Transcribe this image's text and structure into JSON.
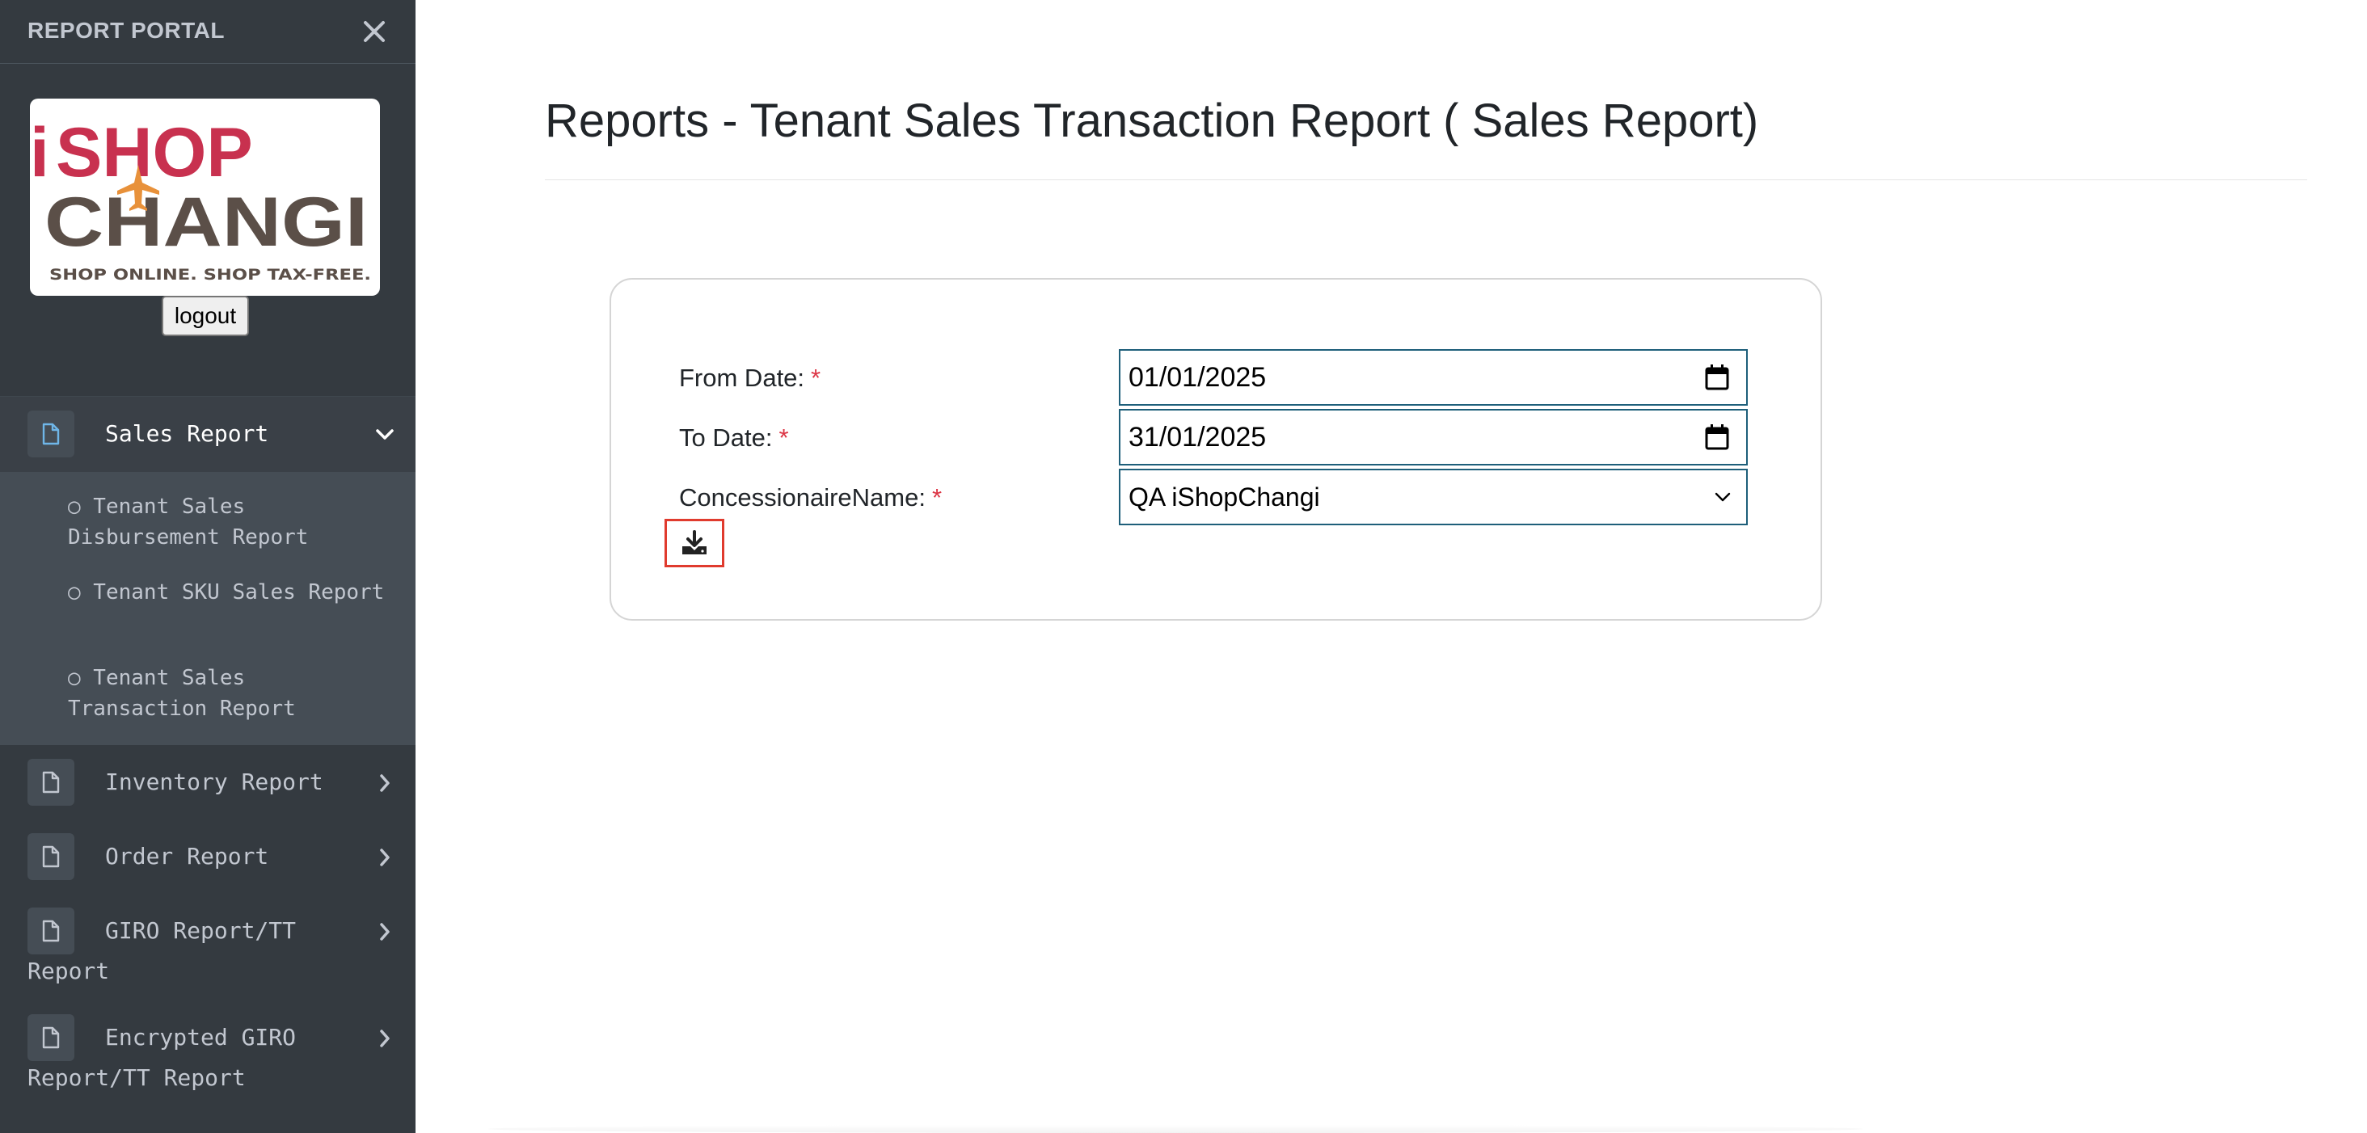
{
  "sidebar": {
    "brand": "REPORT PORTAL",
    "logo": {
      "line1_prefix": "i",
      "line1_main": "SHOP",
      "line2": "CHANGI",
      "tagline": "SHOP ONLINE. SHOP TAX-FREE."
    },
    "logout_label": "logout",
    "nav": [
      {
        "label": "Sales Report",
        "expanded": true,
        "children": [
          "○ Tenant Sales Disbursement Report",
          "○ Tenant SKU Sales Report",
          "○ Tenant Sales Transaction Report"
        ]
      },
      {
        "label": "Inventory Report",
        "expanded": false
      },
      {
        "label": "Order Report",
        "expanded": false
      },
      {
        "label": "GIRO Report/TT Report",
        "expanded": false
      },
      {
        "label": "Encrypted GIRO Report/TT Report",
        "expanded": false
      }
    ]
  },
  "main": {
    "title": "Reports - Tenant Sales Transaction Report ( Sales Report)",
    "form": {
      "from_date": {
        "label": "From Date:",
        "required_mark": "*",
        "value": "01/01/2025"
      },
      "to_date": {
        "label": "To Date:",
        "required_mark": "*",
        "value": "31/01/2025"
      },
      "concessionaire": {
        "label": "ConcessionaireName:",
        "required_mark": "*",
        "value": "QA iShopChangi"
      }
    }
  },
  "colors": {
    "sidebar_bg": "#343a40",
    "sidebar_text": "#c2c7d0",
    "logo_red": "#c8314f",
    "logo_brown": "#5b4f48",
    "logo_plane": "#e8913a",
    "required": "#dc3545",
    "input_border": "#1e5f7a",
    "download_border": "#e03b2e"
  }
}
